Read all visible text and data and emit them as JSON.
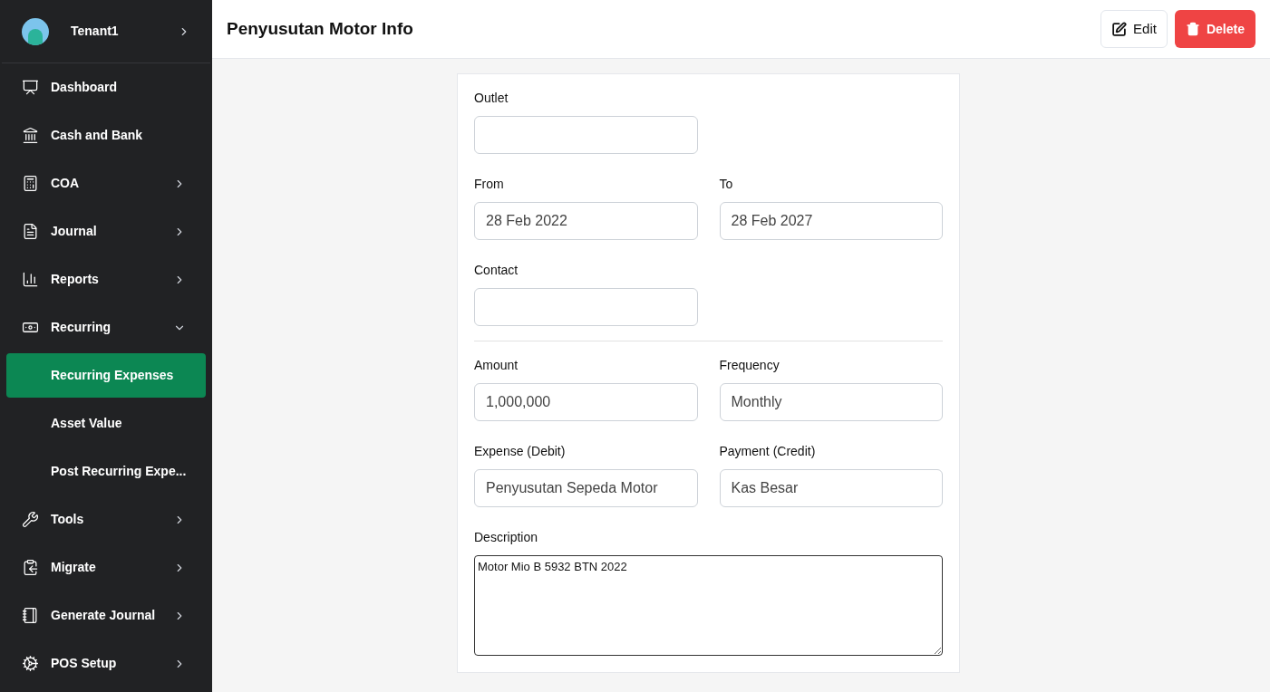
{
  "sidebar": {
    "user": {
      "name": "Tenant1"
    },
    "items": [
      {
        "label": "Dashboard",
        "expandable": false,
        "selected": false
      },
      {
        "label": "Cash and Bank",
        "expandable": false,
        "selected": false
      },
      {
        "label": "COA",
        "expandable": true,
        "expanded": false,
        "selected": false
      },
      {
        "label": "Journal",
        "expandable": true,
        "expanded": false,
        "selected": false
      },
      {
        "label": "Reports",
        "expandable": true,
        "expanded": false,
        "selected": false
      },
      {
        "label": "Recurring",
        "expandable": true,
        "expanded": true,
        "selected": false,
        "children": [
          {
            "label": "Recurring Expenses",
            "selected": true
          },
          {
            "label": "Asset Value",
            "selected": false
          },
          {
            "label": "Post Recurring Expe...",
            "selected": false
          }
        ]
      },
      {
        "label": "Tools",
        "expandable": true,
        "expanded": false,
        "selected": false
      },
      {
        "label": "Migrate",
        "expandable": true,
        "expanded": false,
        "selected": false
      },
      {
        "label": "Generate Journal",
        "expandable": true,
        "expanded": false,
        "selected": false
      },
      {
        "label": "POS Setup",
        "expandable": true,
        "expanded": false,
        "selected": false
      }
    ]
  },
  "header": {
    "title": "Penyusutan Motor Info",
    "buttons": [
      {
        "label": "Edit",
        "kind": "edit"
      },
      {
        "label": "Delete",
        "kind": "delete"
      }
    ]
  },
  "form": {
    "rows": [
      {
        "kind": "fields",
        "fields": [
          {
            "label": "Outlet"
          }
        ]
      },
      {
        "kind": "fields",
        "fields": [
          {
            "label": "From",
            "value": "28 Feb 2022"
          },
          {
            "label": "To",
            "value": "28 Feb 2027"
          }
        ]
      },
      {
        "kind": "fields",
        "fields": [
          {
            "label": "Contact"
          }
        ]
      },
      {
        "kind": "divider"
      },
      {
        "kind": "fields",
        "fields": [
          {
            "label": "Amount",
            "value": "1,000,000"
          },
          {
            "label": "Frequency",
            "value": "Monthly"
          }
        ]
      },
      {
        "kind": "fields",
        "fields": [
          {
            "label": "Expense (Debit)",
            "value": "Penyusutan Sepeda Motor"
          },
          {
            "label": "Payment (Credit)",
            "value": "Kas Besar"
          }
        ]
      },
      {
        "kind": "textarea",
        "label": "Description",
        "value": "Motor Mio B 5932 BTN 2022"
      }
    ]
  }
}
